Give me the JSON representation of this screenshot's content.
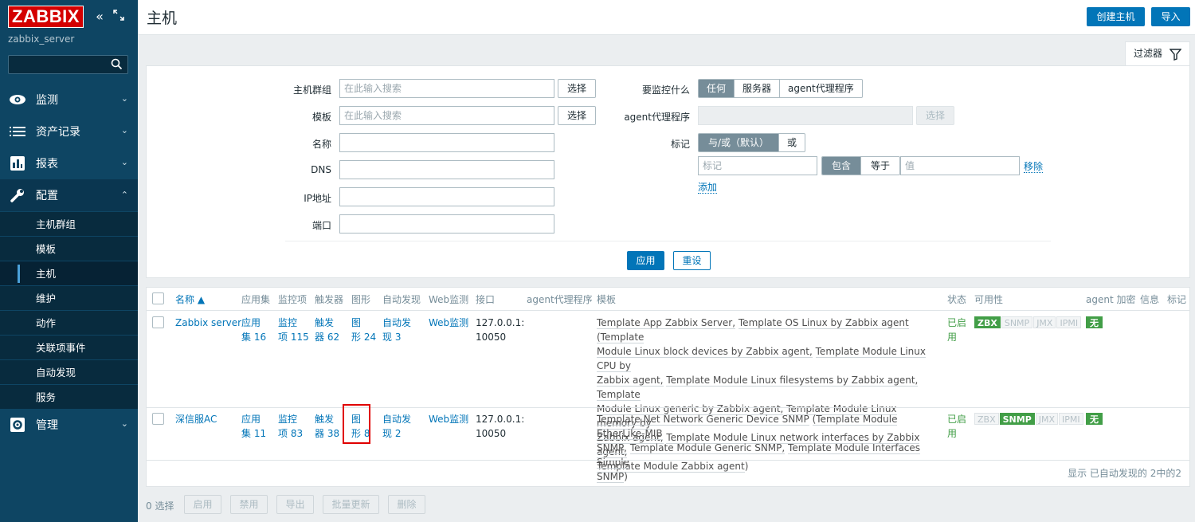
{
  "sidebar": {
    "logo": "ZABBIX",
    "server_name": "zabbix_server",
    "menu": [
      {
        "label": "监测"
      },
      {
        "label": "资产记录"
      },
      {
        "label": "报表"
      },
      {
        "label": "配置"
      },
      {
        "label": "管理"
      }
    ],
    "submenu": [
      "主机群组",
      "模板",
      "主机",
      "维护",
      "动作",
      "关联项事件",
      "自动发现",
      "服务"
    ]
  },
  "header": {
    "title": "主机",
    "create_host": "创建主机",
    "import": "导入"
  },
  "filter": {
    "tab_label": "过滤器",
    "host_groups_label": "主机群组",
    "host_groups_placeholder": "在此输入搜索",
    "templates_label": "模板",
    "templates_placeholder": "在此输入搜索",
    "select_label": "选择",
    "name_label": "名称",
    "dns_label": "DNS",
    "ip_label": "IP地址",
    "port_label": "端口",
    "monitored_by_label": "要监控什么",
    "monitored_by_options": [
      "任何",
      "服务器",
      "agent代理程序"
    ],
    "monitored_by_selected": 0,
    "proxy_label": "agent代理程序",
    "tags_label": "标记",
    "tags_mode_options": [
      "与/或（默认）",
      "或"
    ],
    "tag_placeholder": "标记",
    "tag_op_options": [
      "包含",
      "等于"
    ],
    "value_placeholder": "值",
    "remove": "移除",
    "add": "添加",
    "apply": "应用",
    "reset": "重设"
  },
  "table": {
    "headers": [
      "名称 ▲",
      "应用集",
      "监控项",
      "触发器",
      "图形",
      "自动发现",
      "Web监测",
      "接口",
      "agent代理程序",
      "模板",
      "状态",
      "可用性",
      "agent 加密",
      "信息",
      "标记"
    ],
    "rows": [
      {
        "name": "Zabbix server",
        "apps": [
          "应用",
          "集 16"
        ],
        "items": [
          "监控",
          "项 115"
        ],
        "triggers": [
          "触发",
          "器 62"
        ],
        "graphs": [
          "图",
          "形 24"
        ],
        "discovery": [
          "自动发",
          "现 3"
        ],
        "web": "Web监测",
        "interface": [
          "127.0.0.1:",
          "10050"
        ],
        "templates": [
          "Template App Zabbix Server,",
          "Template OS Linux by Zabbix agent",
          "(Template",
          "Module Linux block devices by Zabbix agent,",
          "Template Module Linux CPU by",
          "Zabbix agent,",
          "Template Module Linux filesystems by Zabbix agent,",
          "Template",
          "Module Linux generic by Zabbix agent,",
          "Template Module Linux memory by",
          "Zabbix agent,",
          "Template Module Linux network interfaces by Zabbix agent,",
          "Template Module Zabbix agent",
          ")"
        ],
        "status": [
          "已启",
          "用"
        ],
        "availability": [
          "ZBX",
          "SNMP",
          "JMX",
          "IPMI"
        ],
        "avail_on": 0,
        "encryption": "无"
      },
      {
        "name": "深信服AC",
        "apps": [
          "应用",
          "集 11"
        ],
        "items": [
          "监控",
          "项 83"
        ],
        "triggers": [
          "触发",
          "器 38"
        ],
        "graphs": [
          "图",
          "形 8"
        ],
        "discovery": [
          "自动发",
          "现 2"
        ],
        "web": "Web监测",
        "interface": [
          "127.0.0.1:",
          "10050"
        ],
        "templates": [
          "Template Net Network Generic Device SNMP",
          "(Template Module EtherLike-MIB",
          "SNMP,",
          "Template Module Generic SNMP,",
          "Template Module Interfaces Simple",
          "SNMP",
          ")"
        ],
        "status": [
          "已启",
          "用"
        ],
        "availability": [
          "ZBX",
          "SNMP",
          "JMX",
          "IPMI"
        ],
        "avail_on": 1,
        "encryption": "无"
      }
    ],
    "footer": "显示 已自动发现的 2中的2"
  },
  "actions": {
    "selected": "0 选择",
    "buttons": [
      "启用",
      "禁用",
      "导出",
      "批量更新",
      "删除"
    ]
  }
}
